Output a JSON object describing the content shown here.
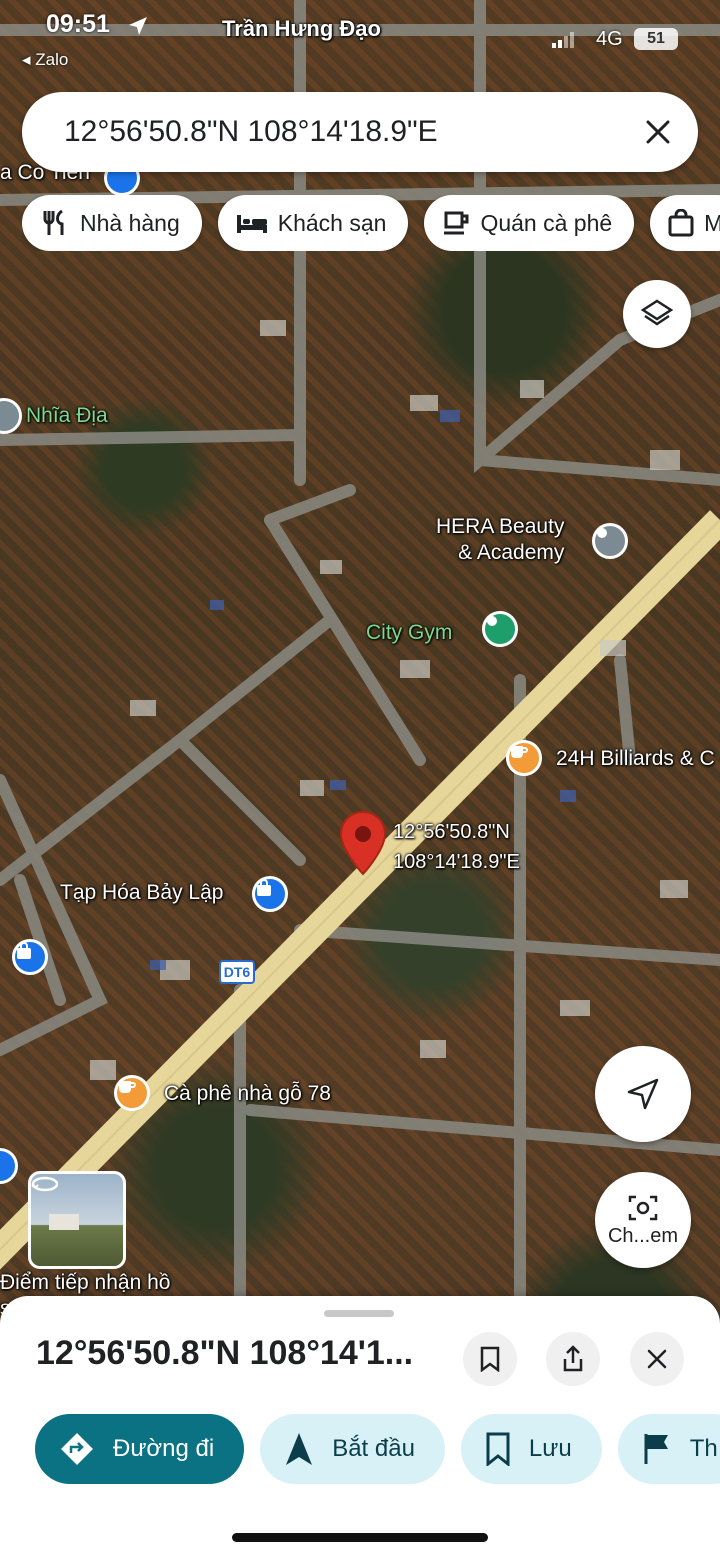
{
  "status_bar": {
    "time": "09:51",
    "back_app": "◂ Zalo",
    "network": "4G",
    "battery": "51"
  },
  "search": {
    "value": "12°56'50.8\"N 108°14'18.9\"E"
  },
  "chips": [
    {
      "label": "Nhà hàng",
      "icon": "fork-knife-icon"
    },
    {
      "label": "Khách sạn",
      "icon": "bed-icon"
    },
    {
      "label": "Quán cà phê",
      "icon": "coffee-cup-icon"
    },
    {
      "label": "M",
      "icon": "shopping-bag-icon"
    }
  ],
  "map": {
    "labels": {
      "street_top": "Trần Hưng Đạo",
      "co_tien": "a Co Tiên",
      "nghia_dia": "Nhĩa Địa",
      "hera": "HERA Beauty\n& Academy",
      "city_gym": "City Gym",
      "billiards": "24H Billiards & C",
      "coords_line1": "12°56'50.8\"N",
      "coords_line2": "108°14'18.9\"E",
      "tap_hoa": "Tạp Hóa Bảy Lập",
      "road_badge": "DT6",
      "ca_phe": "Cà phê nhà gỗ 78",
      "diem": "Điểm tiếp nhận hồ",
      "diem2": "s"
    },
    "lens_label": "Ch...em",
    "accent_pin": "#d93025",
    "poi_colors": {
      "coffee": "#f29b38",
      "gym": "#1e9e6a",
      "shop": "#1a73e8",
      "service": "#7b8a93"
    }
  },
  "sheet": {
    "title": "12°56'50.8\"N 108°14'1...",
    "actions": [
      {
        "label": "Đường đi",
        "icon": "directions-icon"
      },
      {
        "label": "Bắt đầu",
        "icon": "navigation-arrow-icon"
      },
      {
        "label": "Lưu",
        "icon": "bookmark-icon"
      },
      {
        "label": "Th",
        "icon": "flag-icon"
      }
    ]
  }
}
